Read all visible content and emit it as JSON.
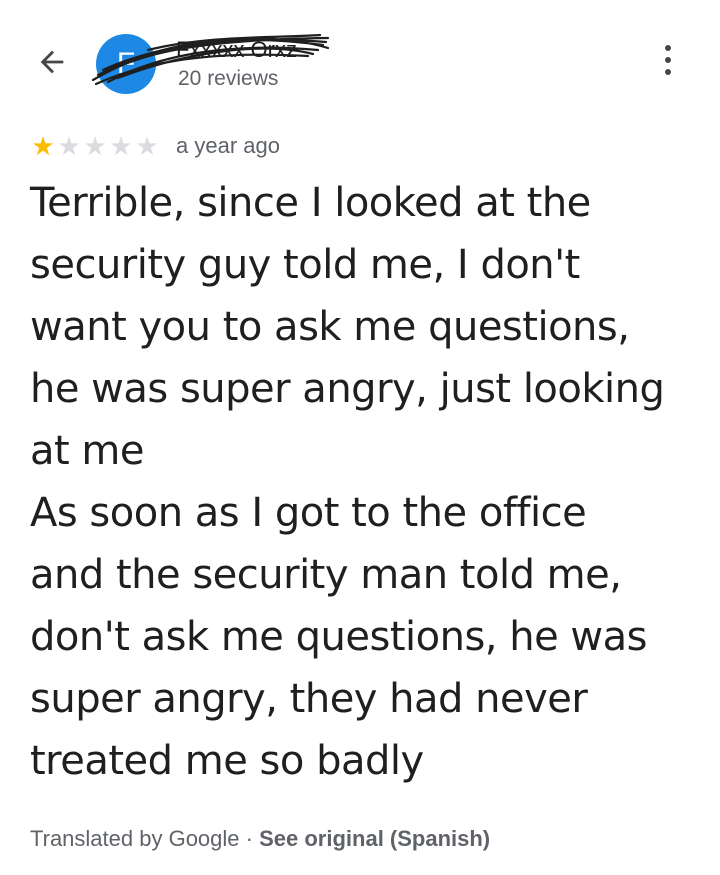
{
  "header": {
    "avatar_letter": "F",
    "reviewer_name": "Fxxxxx Orxz",
    "review_count": "20 reviews"
  },
  "review": {
    "rating": 1,
    "max_rating": 5,
    "date": "a year ago",
    "lines": [
      "Terrible, since I looked at the",
      "security guy told me, I don't",
      "want you to ask me questions,",
      "he was super angry, just looking",
      "at me",
      "As soon as I got to the office",
      "and the security man told me,",
      "don't ask me questions, he was",
      "super angry, they had never",
      "treated me so badly"
    ]
  },
  "translation": {
    "label": "Translated by Google",
    "separator": " · ",
    "see_original": "See original (Spanish)"
  },
  "colors": {
    "star_filled": "#fbbc04",
    "star_empty": "#dadce0",
    "avatar_bg": "#1e88e5",
    "secondary_text": "#5f6368"
  },
  "icons": {
    "back": "arrow-back-icon",
    "more": "more-vert-icon",
    "star": "star-icon"
  }
}
